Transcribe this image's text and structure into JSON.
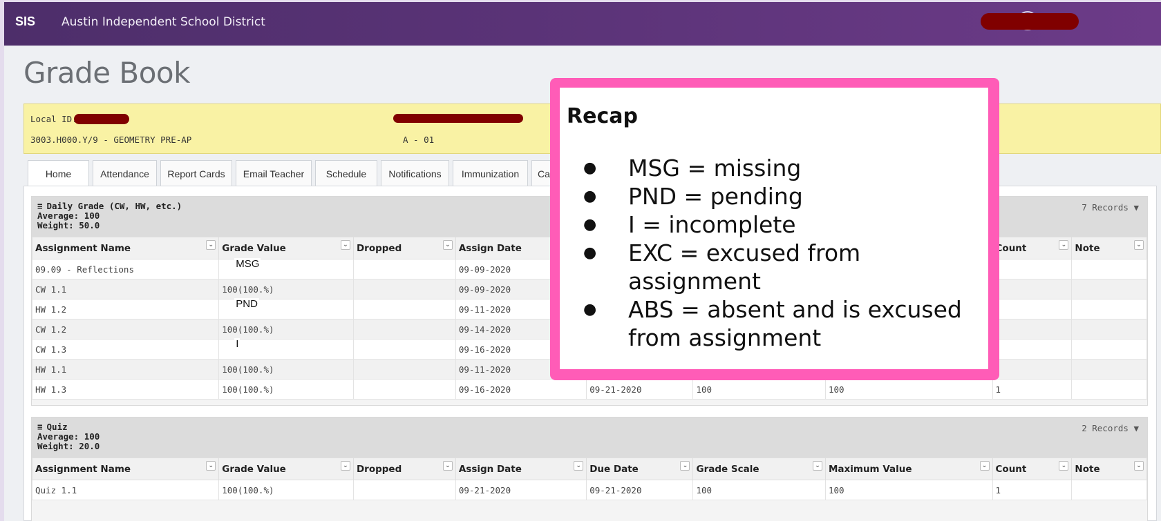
{
  "header": {
    "brand": "SIS",
    "district": "Austin Independent School District",
    "help_icon": "?"
  },
  "page": {
    "title": "Grade Book"
  },
  "info": {
    "local_id_label": "Local ID:",
    "course": "3003.H000.Y/9 - GEOMETRY PRE-AP",
    "section": "A - 01"
  },
  "tabs": [
    {
      "label": "Home"
    },
    {
      "label": "Attendance"
    },
    {
      "label": "Report Cards"
    },
    {
      "label": "Email Teacher"
    },
    {
      "label": "Schedule"
    },
    {
      "label": "Notifications"
    },
    {
      "label": "Immunization"
    },
    {
      "label": "Ca"
    }
  ],
  "columns": [
    "Assignment Name",
    "Grade Value",
    "Dropped",
    "Assign Date",
    "Due Date",
    "Grade Scale",
    "Maximum Value",
    "Count",
    "Note"
  ],
  "daily": {
    "title": "Daily Grade (CW, HW, etc.)",
    "average": "Average: 100",
    "weight": "Weight: 50.0",
    "records": "7 Records",
    "rows": [
      {
        "name": "09.09 - Reflections",
        "grade": "",
        "mark": "MSG",
        "dropped": "",
        "assign": "09-09-2020",
        "due": "",
        "scale": "",
        "max": "",
        "count": "",
        "note": ""
      },
      {
        "name": "CW 1.1",
        "grade": "100(100.%)",
        "mark": "",
        "dropped": "",
        "assign": "09-09-2020",
        "due": "",
        "scale": "",
        "max": "",
        "count": "",
        "note": ""
      },
      {
        "name": "HW 1.2",
        "grade": "",
        "mark": "PND",
        "dropped": "",
        "assign": "09-11-2020",
        "due": "",
        "scale": "",
        "max": "",
        "count": "",
        "note": ""
      },
      {
        "name": "CW 1.2",
        "grade": "100(100.%)",
        "mark": "",
        "dropped": "",
        "assign": "09-14-2020",
        "due": "",
        "scale": "",
        "max": "",
        "count": "",
        "note": ""
      },
      {
        "name": "CW 1.3",
        "grade": "",
        "mark": "I",
        "dropped": "",
        "assign": "09-16-2020",
        "due": "",
        "scale": "",
        "max": "",
        "count": "",
        "note": ""
      },
      {
        "name": "HW 1.1",
        "grade": "100(100.%)",
        "mark": "",
        "dropped": "",
        "assign": "09-11-2020",
        "due": "",
        "scale": "",
        "max": "",
        "count": "",
        "note": ""
      },
      {
        "name": "HW 1.3",
        "grade": "100(100.%)",
        "mark": "",
        "dropped": "",
        "assign": "09-16-2020",
        "due": "09-21-2020",
        "scale": "100",
        "max": "100",
        "count": "1",
        "note": ""
      }
    ]
  },
  "quiz": {
    "title": "Quiz",
    "average": "Average: 100",
    "weight": "Weight: 20.0",
    "records": "2 Records",
    "rows": [
      {
        "name": "Quiz 1.1",
        "grade": "100(100.%)",
        "dropped": "",
        "assign": "09-21-2020",
        "due": "09-21-2020",
        "scale": "100",
        "max": "100",
        "count": "1",
        "note": ""
      }
    ]
  },
  "recap": {
    "title": "Recap",
    "items": [
      "MSG = missing",
      "PND = pending",
      "I = incomplete",
      "EXC = excused from assignment",
      "ABS = absent and is excused from assignment"
    ]
  },
  "colors": {
    "topbar": "#5a3377",
    "recap_border": "#ff5cb7",
    "info_bg": "#f9f2a4",
    "redaction": "#800000"
  }
}
